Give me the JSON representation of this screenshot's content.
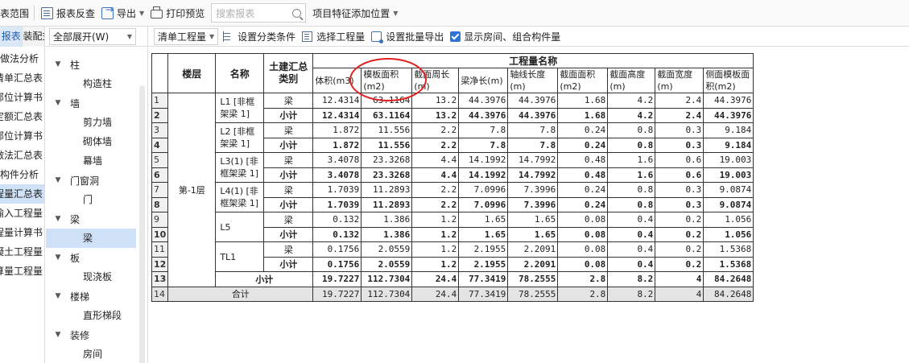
{
  "toolbar": {
    "range_label": "设置报表范围",
    "report_check": "报表反查",
    "export": "导出",
    "print_preview": "打印预览",
    "search_placeholder": "搜索报表",
    "add_position": "项目特征添加位置"
  },
  "left_strip": {
    "tabs": [
      "报表",
      "装配式"
    ],
    "items": [
      "做法分析",
      "清单汇总表",
      "清单部位计算书",
      "清单定额汇总表",
      "清单定额部位计算书",
      "构件做法汇总表",
      "构件分析",
      "绘图输入工程量汇总表",
      "构件绘图输入工程量",
      "绘图输入构件工程量计算书",
      "高强节点混凝土工程量",
      "表格算量工程量"
    ]
  },
  "tree": {
    "expand_label": "全部展开(W)",
    "groups": [
      {
        "label": "柱",
        "children": [
          "构造柱"
        ]
      },
      {
        "label": "墙",
        "children": [
          "剪力墙",
          "砌体墙",
          "幕墙"
        ]
      },
      {
        "label": "门窗洞",
        "children": [
          "门"
        ]
      },
      {
        "label": "梁",
        "children": [
          "梁"
        ]
      },
      {
        "label": "板",
        "children": [
          "现浇板"
        ]
      },
      {
        "label": "楼梯",
        "children": [
          "直形梯段"
        ]
      },
      {
        "label": "装修",
        "children": [
          "房间"
        ]
      }
    ]
  },
  "subtoolbar": {
    "mode": "清单工程量",
    "set_category": "设置分类条件",
    "select_quantity": "选择工程量",
    "batch_export": "设置批量导出",
    "show_rooms": "显示房间、组合构件量"
  },
  "table": {
    "headers": {
      "floor": "楼层",
      "name": "名称",
      "category": "土建汇总类别",
      "group": "工程量名称",
      "columns": [
        "体积(m3)",
        "模板面积(m2)",
        "截面周长(m)",
        "梁净长(m)",
        "轴线长度(m)",
        "截面面积(m2)",
        "截面高度(m)",
        "截面宽度(m)",
        "侧面模板面积(m2)"
      ]
    },
    "floor": "第-1层",
    "groups": [
      {
        "name": "L1 [非框架梁 1]",
        "cat": "梁",
        "sub": "小计",
        "values": [
          "12.4314",
          "63.1164",
          "13.2",
          "44.3976",
          "44.3976",
          "1.68",
          "4.2",
          "2.4",
          "44.3976"
        ]
      },
      {
        "name": "L2 [非框架梁 1]",
        "cat": "梁",
        "sub": "小计",
        "values": [
          "1.872",
          "11.556",
          "2.2",
          "7.8",
          "7.8",
          "0.24",
          "0.8",
          "0.3",
          "9.184"
        ]
      },
      {
        "name": "L3(1) [非框架梁 1]",
        "cat": "梁",
        "sub": "小计",
        "values": [
          "3.4078",
          "23.3268",
          "4.4",
          "14.1992",
          "14.7992",
          "0.48",
          "1.6",
          "0.6",
          "19.003"
        ]
      },
      {
        "name": "L4(1) [非框架梁 1]",
        "cat": "梁",
        "sub": "小计",
        "values": [
          "1.7039",
          "11.2893",
          "2.2",
          "7.0996",
          "7.3996",
          "0.24",
          "0.8",
          "0.3",
          "9.0874"
        ]
      },
      {
        "name": "L5",
        "cat": "梁",
        "sub": "小计",
        "values": [
          "0.132",
          "1.386",
          "1.2",
          "1.65",
          "1.65",
          "0.08",
          "0.4",
          "0.2",
          "1.056"
        ]
      },
      {
        "name": "TL1",
        "cat": "梁",
        "sub": "小计",
        "values": [
          "0.1756",
          "2.0559",
          "1.2",
          "2.1955",
          "2.2091",
          "0.08",
          "0.4",
          "0.2",
          "1.5368"
        ]
      }
    ],
    "floor_subtotal": {
      "label": "小计",
      "values": [
        "19.7227",
        "112.7304",
        "24.4",
        "77.3419",
        "78.2555",
        "2.8",
        "8.2",
        "4",
        "84.2648"
      ]
    },
    "grand_total": {
      "label": "合计",
      "values": [
        "19.7227",
        "112.7304",
        "24.4",
        "77.3419",
        "78.2555",
        "2.8",
        "8.2",
        "4",
        "84.2648"
      ]
    },
    "row_numbers": [
      "1",
      "2",
      "3",
      "4",
      "5",
      "6",
      "7",
      "8",
      "9",
      "10",
      "11",
      "12",
      "13",
      "14"
    ]
  },
  "annotation": {
    "color": "#e02020"
  }
}
